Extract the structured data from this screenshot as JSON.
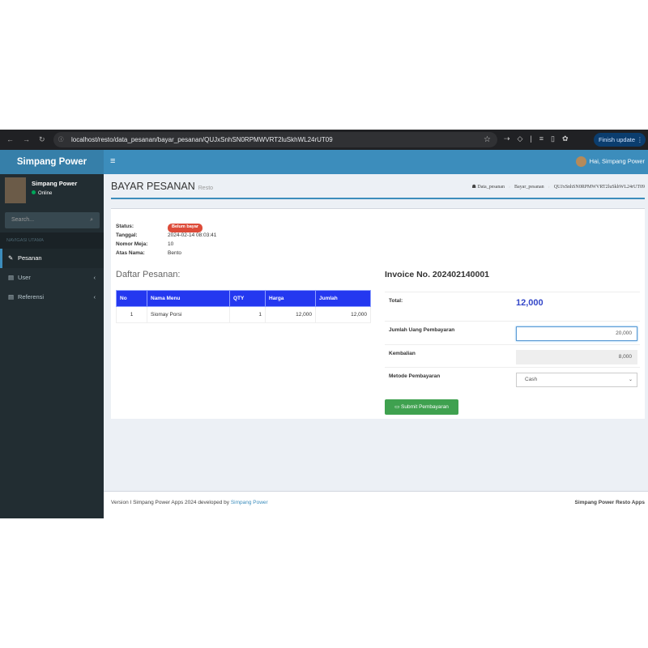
{
  "browser": {
    "url": "localhost/resto/data_pesanan/bayar_pesanan/QUJxSnhSN0RPMWVRT2luSkhWL24rUT09",
    "finish_update": "Finish update"
  },
  "app": {
    "logo": "Simpang Power",
    "greeting": "Hai, Simpang Power"
  },
  "sidebar": {
    "user_name": "Simpang Power",
    "status": "Online",
    "search_placeholder": "Search...",
    "nav_header": "NAVIGASI UTAMA",
    "items": [
      {
        "label": "Pesanan"
      },
      {
        "label": "User"
      },
      {
        "label": "Referensi"
      }
    ]
  },
  "page": {
    "title": "BAYAR PESANAN",
    "subtitle": "Resto",
    "breadcrumb": [
      "Data_pesanan",
      "Bayar_pesanan",
      "QUJxSnhSN0RPMWVRT2luSkhWL24rUT09"
    ]
  },
  "order": {
    "status_label": "Status:",
    "status": "Belum bayar",
    "date_label": "Tanggal:",
    "date": "2024-02-14 08:03:41",
    "table_label": "Nomor Meja:",
    "table_no": "10",
    "name_label": "Atas Nama:",
    "name": "Bento"
  },
  "list": {
    "title": "Daftar Pesanan:",
    "headers": [
      "No",
      "Nama Menu",
      "QTY",
      "Harga",
      "Jumlah"
    ],
    "rows": [
      [
        "1",
        "Siomay Porsi",
        "1",
        "12,000",
        "12,000"
      ]
    ]
  },
  "invoice": {
    "title": "Invoice No. 202402140001",
    "total_label": "Total:",
    "total": "12,000",
    "paid_label": "Jumlah Uang Pembayaran",
    "paid": "20,000",
    "change_label": "Kembalian",
    "change": "8,000",
    "method_label": "Metode Pembayaran",
    "method": "Cash",
    "submit": "Submit Pembayaran"
  },
  "footer": {
    "left": "Version I Simpang Power Apps 2024 developed by",
    "link": "Simpang Power",
    "right": "Simpang Power Resto Apps"
  }
}
